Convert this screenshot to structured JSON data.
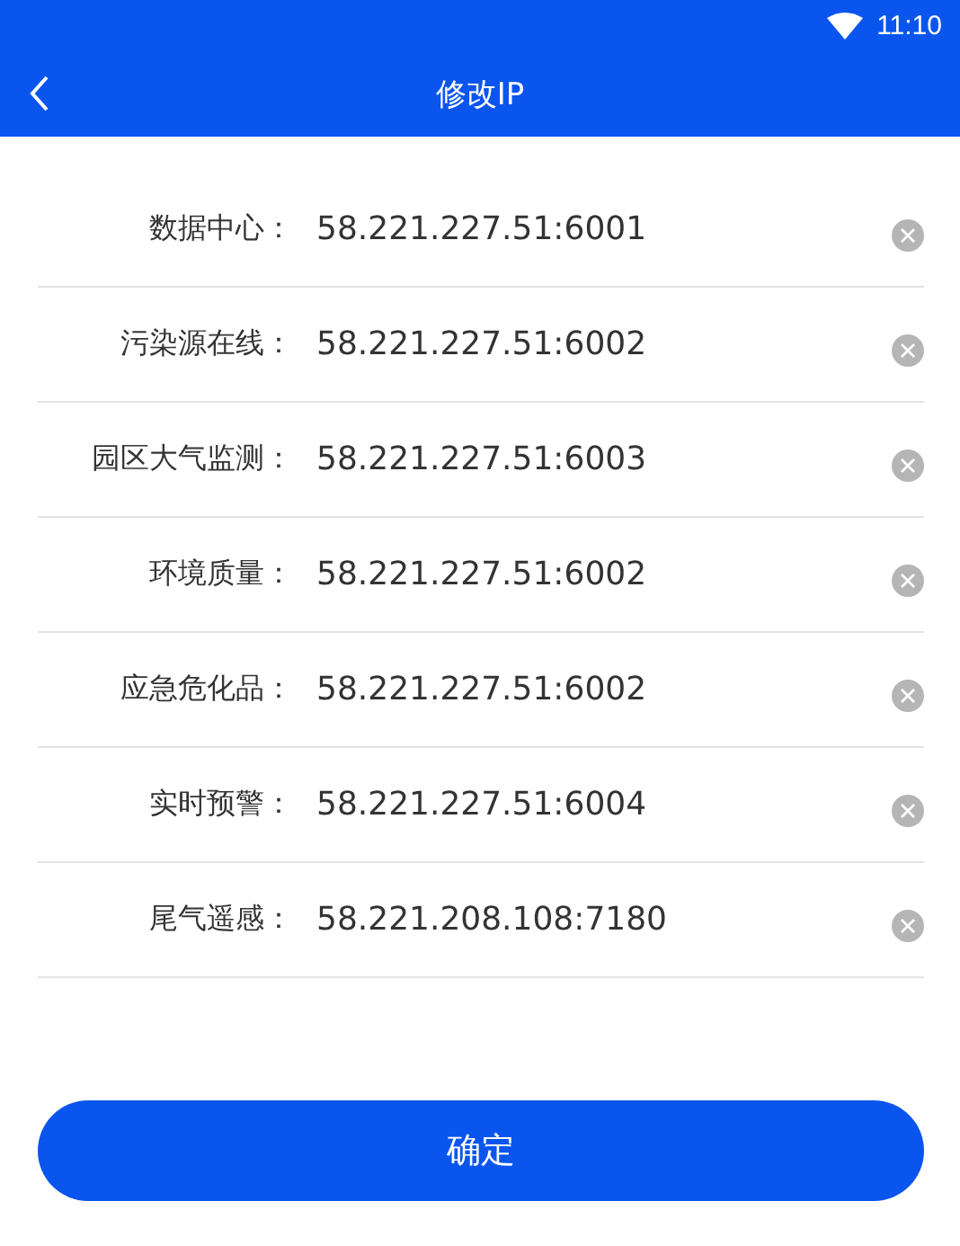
{
  "status_bar": {
    "time": "11:10"
  },
  "header": {
    "title": "修改IP"
  },
  "fields": [
    {
      "label": "数据中心：",
      "value": "58.221.227.51:6001"
    },
    {
      "label": "污染源在线：",
      "value": "58.221.227.51:6002"
    },
    {
      "label": "园区大气监测：",
      "value": "58.221.227.51:6003"
    },
    {
      "label": "环境质量：",
      "value": "58.221.227.51:6002"
    },
    {
      "label": "应急危化品：",
      "value": "58.221.227.51:6002"
    },
    {
      "label": "实时预警：",
      "value": "58.221.227.51:6004"
    },
    {
      "label": "尾气遥感：",
      "value": "58.221.208.108:7180"
    }
  ],
  "confirm_button": "确定"
}
